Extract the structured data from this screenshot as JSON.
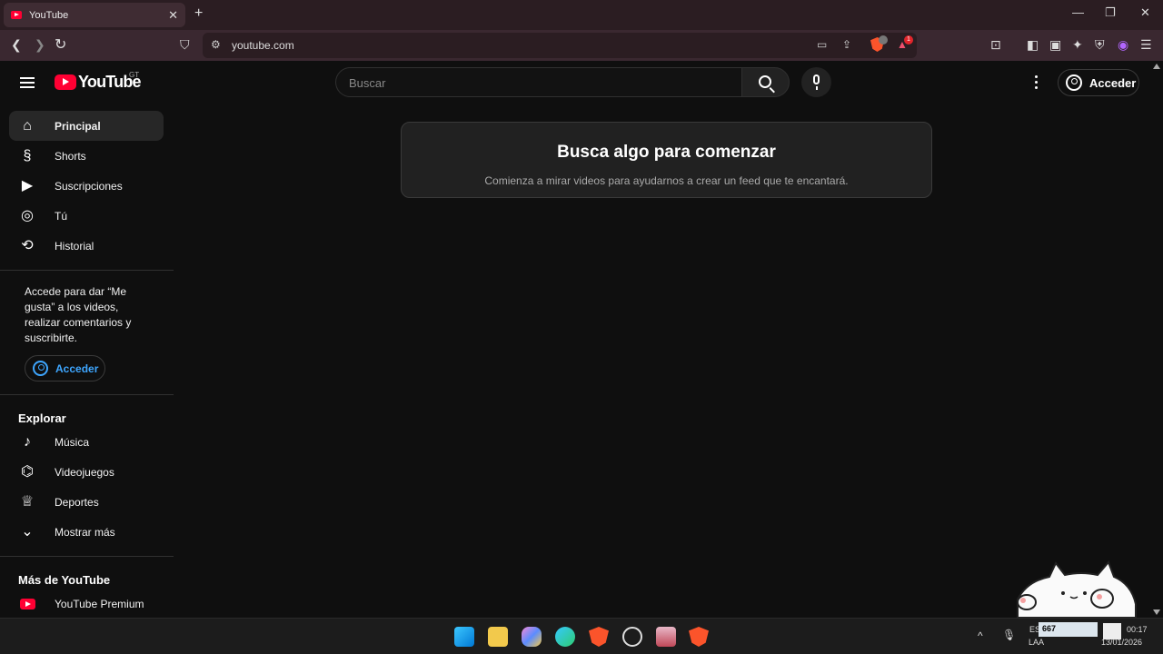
{
  "browser": {
    "tab_title": "YouTube",
    "url": "youtube.com",
    "badges": {
      "brave_shields": "",
      "rewards": "1"
    }
  },
  "header": {
    "country_code": "GT",
    "logo_text": "YouTube",
    "search_placeholder": "Buscar",
    "signin_label": "Acceder"
  },
  "sidebar": {
    "main_items": [
      {
        "label": "Principal",
        "icon": "home-icon"
      },
      {
        "label": "Shorts",
        "icon": "shorts-icon"
      },
      {
        "label": "Suscripciones",
        "icon": "subscriptions-icon"
      },
      {
        "label": "Tú",
        "icon": "you-icon"
      },
      {
        "label": "Historial",
        "icon": "history-icon"
      }
    ],
    "signin_message": "Accede para dar “Me gusta” a los videos, realizar comentarios y suscribirte.",
    "signin_button": "Acceder",
    "explore_title": "Explorar",
    "explore_items": [
      {
        "label": "Música",
        "icon": "music-icon"
      },
      {
        "label": "Videojuegos",
        "icon": "gaming-icon"
      },
      {
        "label": "Deportes",
        "icon": "trophy-icon"
      },
      {
        "label": "Mostrar más",
        "icon": "chevron-down-icon"
      }
    ],
    "more_title": "Más de YouTube",
    "more_items": [
      {
        "label": "YouTube Premium",
        "icon": "youtube-premium-icon"
      }
    ]
  },
  "main": {
    "card_title": "Busca algo para comenzar",
    "card_subtitle": "Comienza a mirar videos para ayudarnos a crear un feed que te encantará."
  },
  "taskbar": {
    "lang_top": "ES",
    "lang_bottom": "LAA",
    "counter": "667",
    "time": "00:17",
    "date": "13/01/2026"
  },
  "colors": {
    "accent_red": "#ff0033",
    "link_blue": "#3ea6ff",
    "page_bg": "#0f0f0f"
  }
}
